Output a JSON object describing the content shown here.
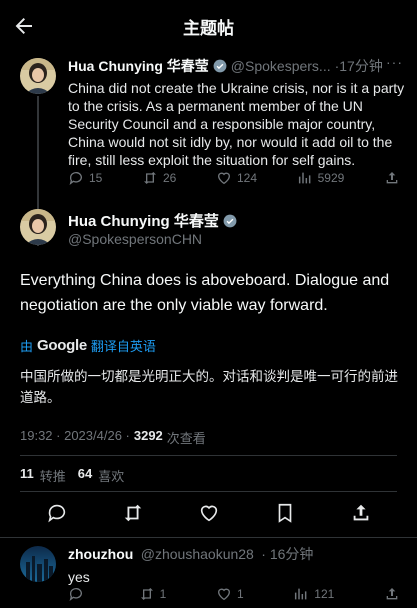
{
  "header": {
    "title": "主题帖"
  },
  "tweet1": {
    "name": "Hua Chunying 华春莹",
    "handle": "@Spokespers...",
    "time": "·17分钟",
    "more": "···",
    "text": "China did not create the Ukraine crisis, nor is it a party to the crisis. As a permanent member of the UN Security Council and a responsible major country, China would not sit idly by, nor would it add oil to the fire, still less exploit the situation for self gains.",
    "replies": "15",
    "retweets": "26",
    "likes": "124",
    "views": "5929"
  },
  "main_tweet": {
    "name": "Hua Chunying 华春莹",
    "handle": "@SpokespersonCHN",
    "text": "Everything China does is aboveboard. Dialogue and negotiation are the only viable way forward.",
    "translated_by": "由",
    "google": "Google",
    "translate_label": "翻译自英语",
    "translation": "中国所做的一切都是光明正大的。对话和谈判是唯一可行的前进道路。",
    "timestamp": "19:32 · 2023/4/26 ·",
    "views": "3292",
    "views_label": "次查看",
    "retweet_count": "11",
    "retweet_label": "转推",
    "like_count": "64",
    "like_label": "喜欢"
  },
  "reply": {
    "name": "zhouzhou",
    "handle": "@zhoushaokun28",
    "time": "· 16分钟",
    "text": "yes",
    "replies": "",
    "retweets": "1",
    "likes": "1",
    "views": "121"
  },
  "colors": {
    "accent": "#1d9bf0",
    "muted": "#71767b",
    "background": "#000000"
  }
}
